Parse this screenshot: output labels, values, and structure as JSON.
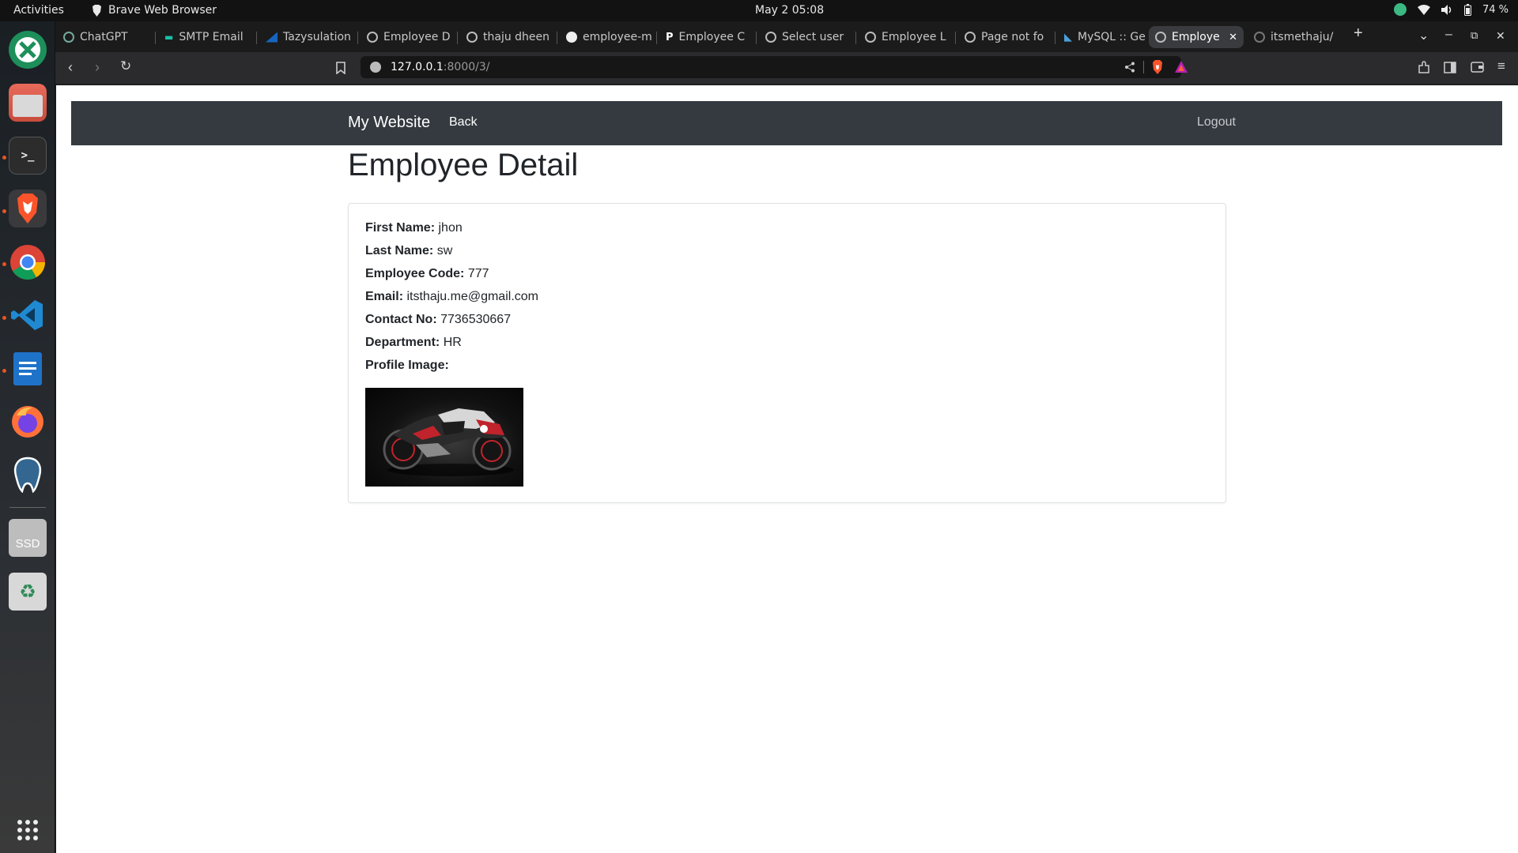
{
  "topbar": {
    "activities": "Activities",
    "app_name": "Brave Web Browser",
    "clock": "May 2  05:08",
    "battery": "74 %"
  },
  "browser": {
    "tabs": [
      {
        "label": "ChatGPT"
      },
      {
        "label": "SMTP Email"
      },
      {
        "label": "Tazysulation"
      },
      {
        "label": "Employee D"
      },
      {
        "label": "thaju dheen"
      },
      {
        "label": "employee-m"
      },
      {
        "label": "Employee C"
      },
      {
        "label": "Select user"
      },
      {
        "label": "Employee L"
      },
      {
        "label": "Page not fo"
      },
      {
        "label": "MySQL :: Ge"
      },
      {
        "label": "Employe"
      },
      {
        "label": "itsmethaju/"
      }
    ],
    "active_tab_index": 11,
    "url_host": "127.0.0.1",
    "url_rest": ":8000/3/"
  },
  "site": {
    "brand": "My Website",
    "back": "Back",
    "logout": "Logout",
    "nav_color": "#343a40"
  },
  "detail": {
    "title": "Employee Detail",
    "first_name_label": "First Name:",
    "first_name": "jhon",
    "last_name_label": "Last Name:",
    "last_name": "sw",
    "code_label": "Employee Code:",
    "code": "777",
    "email_label": "Email:",
    "email": "itsthaju.me@gmail.com",
    "contact_label": "Contact No:",
    "contact": "7736530667",
    "department_label": "Department:",
    "department": "HR",
    "image_label": "Profile Image:"
  },
  "dock": {
    "ssd_label": "SSD"
  }
}
